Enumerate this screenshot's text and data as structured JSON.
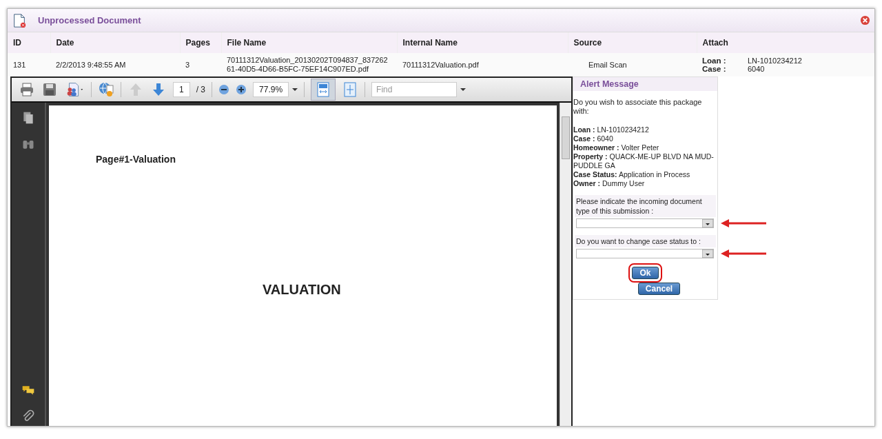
{
  "window": {
    "title": "Unprocessed Document"
  },
  "table": {
    "columns": [
      "ID",
      "Date",
      "Pages",
      "File Name",
      "Internal Name",
      "Source",
      "Attach"
    ],
    "rows": [
      {
        "id": "131",
        "date": "2/2/2013 9:48:55 AM",
        "pages": "3",
        "file_name": "70111312Valuation_20130202T094837_83726261-40D5-4D66-B5FC-75EF14C907ED.pdf",
        "internal_name": "70111312Valuation.pdf",
        "source": "Email Scan",
        "attach": [
          {
            "label": "Loan :",
            "value": "LN-1010234212"
          },
          {
            "label": "Case :",
            "value": "6040"
          }
        ]
      }
    ]
  },
  "viewer": {
    "toolbar": {
      "page": "1",
      "page_total": "/ 3",
      "zoom": "77.9%",
      "find_placeholder": "Find"
    },
    "page": {
      "heading": "Page#1-Valuation",
      "title": "VALUATION"
    }
  },
  "alert": {
    "title": "Alert Message",
    "intro": "Do you wish to associate this package with:",
    "details": [
      "**Loan :** LN-1010234212",
      "**Case :** 6040",
      "**Homeowner :** Volter Peter",
      "**Property :** QUACK-ME-UP BLVD NA MUD-PUDDLE GA",
      "**Case Status:** Application in Process",
      "**Owner :** Dummy User"
    ],
    "fields": [
      {
        "label": "Please indicate the incoming document type of this submission :",
        "arrow": true
      },
      {
        "label": "Do you want to change case status to :",
        "arrow": true
      }
    ],
    "buttons": [
      {
        "label": "Ok",
        "highlighted": true
      },
      {
        "label": "Cancel",
        "highlighted": false
      }
    ]
  }
}
